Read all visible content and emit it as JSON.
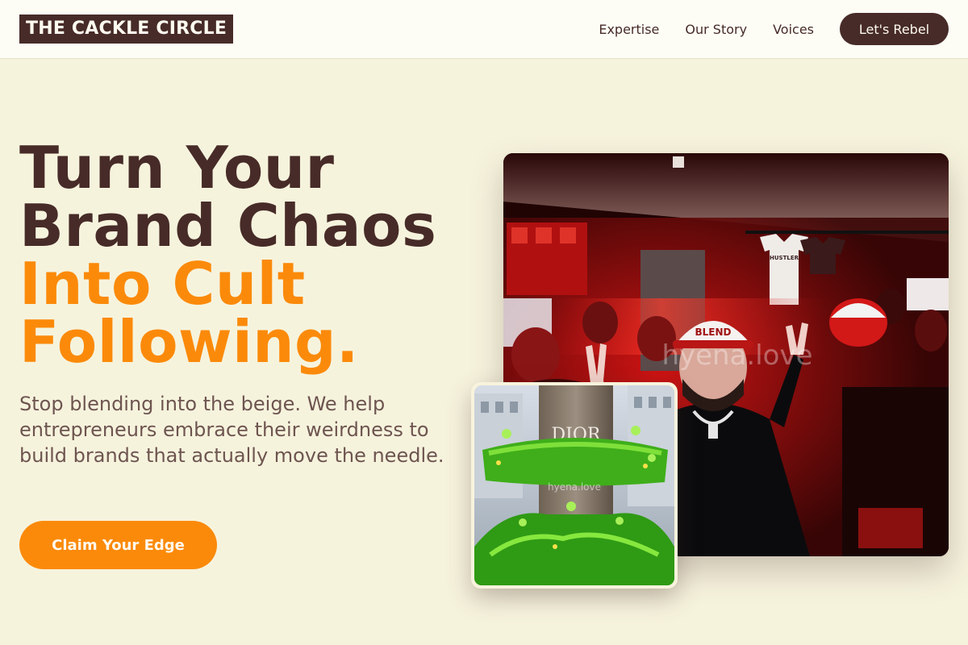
{
  "header": {
    "logo": "THE CACKLE CIRCLE",
    "nav": [
      "Expertise",
      "Our Story",
      "Voices"
    ],
    "cta": "Let's Rebel"
  },
  "hero": {
    "title_lines": [
      "Turn Your",
      "Brand Chaos"
    ],
    "title_accent_lines": [
      "Into Cult",
      "Following."
    ],
    "subtitle": "Stop blending into the beige. We help entrepreneurs embrace their weirdness to build brands that actually move the needle.",
    "cta": "Claim Your Edge"
  },
  "images": {
    "main": {
      "watermark": "hyena.love",
      "shirt_text": "HUSTLER",
      "cap_text": "BLEND"
    },
    "small": {
      "sign_text": "DIOR",
      "watermark": "hyena.love"
    }
  },
  "colors": {
    "background": "#f6f3dd",
    "brand_dark": "#472b28",
    "accent": "#fb8a0a",
    "header_bg": "#fdfdf6"
  }
}
